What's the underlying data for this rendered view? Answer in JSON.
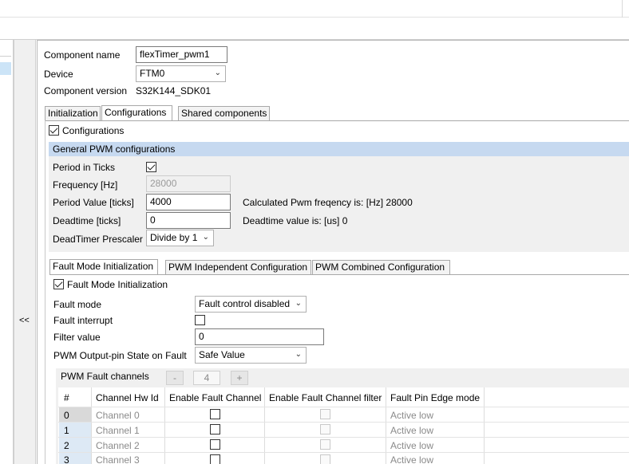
{
  "collapse_button": "<<",
  "component": {
    "name_label": "Component name",
    "name_value": "flexTimer_pwm1",
    "device_label": "Device",
    "device_value": "FTM0",
    "version_label": "Component version",
    "version_value": "S32K144_SDK01"
  },
  "top_tabs": [
    "Initialization",
    "Configurations",
    "Shared components"
  ],
  "configurations_check_label": "Configurations",
  "general": {
    "header": "General PWM configurations",
    "period_in_ticks_label": "Period in Ticks",
    "frequency_label": "Frequency [Hz]",
    "frequency_value": "28000",
    "period_value_label": "Period Value [ticks]",
    "period_value": "4000",
    "calc_pwm_text": "Calculated Pwm freqency is: [Hz] 28000",
    "deadtime_label": "Deadtime [ticks]",
    "deadtime_value": "0",
    "deadtime_value_text": "Deadtime value is: [us] 0",
    "prescaler_label": "DeadTimer Prescaler",
    "prescaler_value": "Divide by 1"
  },
  "sub_tabs": [
    "Fault Mode Initialization",
    "PWM Independent Configuration",
    "PWM Combined Configuration"
  ],
  "fault": {
    "check_label": "Fault Mode Initialization",
    "mode_label": "Fault mode",
    "mode_value": "Fault control disabled",
    "interrupt_label": "Fault interrupt",
    "filter_label": "Filter value",
    "filter_value": "0",
    "output_state_label": "PWM Output-pin State on Fault",
    "output_state_value": "Safe Value",
    "channels_header": "PWM Fault channels",
    "minus": "-",
    "count": "4",
    "plus": "+",
    "columns": [
      "#",
      "Channel Hw Id",
      "Enable Fault Channel",
      "Enable Fault Channel filter",
      "Fault Pin Edge mode"
    ],
    "rows": [
      {
        "num": "0",
        "hw": "Channel 0",
        "edge": "Active low"
      },
      {
        "num": "1",
        "hw": "Channel 1",
        "edge": "Active low"
      },
      {
        "num": "2",
        "hw": "Channel 2",
        "edge": "Active low"
      },
      {
        "num": "3",
        "hw": "Channel 3",
        "edge": "Active low"
      }
    ]
  }
}
